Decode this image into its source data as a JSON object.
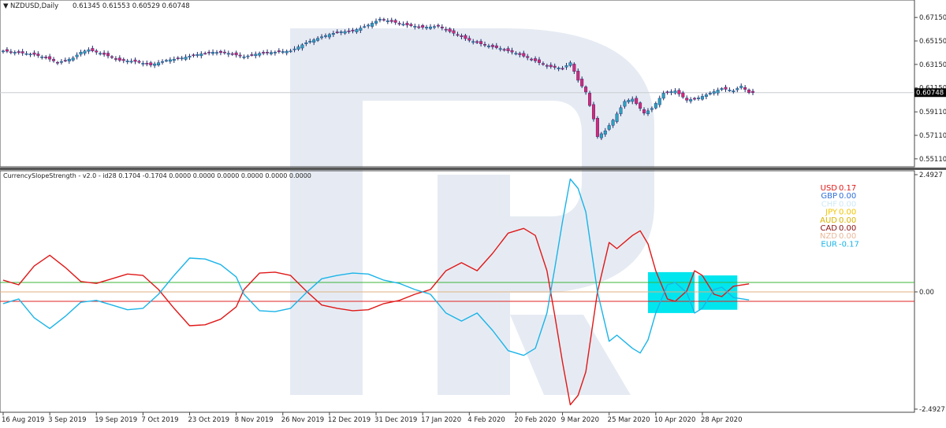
{
  "chart_data": [
    {
      "type": "candlestick",
      "symbol_label": "NZDUSD,Daily",
      "ohlc_label": "0.61345 0.61553 0.60529 0.60748",
      "last_price": 0.60748,
      "last_price_label": "0.60748",
      "ylim": [
        0.547,
        0.681
      ],
      "y_ticks": [
        "0.67150",
        "0.65150",
        "0.63150",
        "0.61150",
        "0.59110",
        "0.57110",
        "0.55110"
      ],
      "y_tick_values": [
        0.6715,
        0.6515,
        0.6315,
        0.6115,
        0.5911,
        0.5711,
        0.5511
      ],
      "x_range": [
        0,
        193
      ],
      "close_series": [
        {
          "x": 0,
          "y": 0.643
        },
        {
          "x": 8,
          "y": 0.64
        },
        {
          "x": 12,
          "y": 0.636
        },
        {
          "x": 14,
          "y": 0.633
        },
        {
          "x": 18,
          "y": 0.637
        },
        {
          "x": 20,
          "y": 0.642
        },
        {
          "x": 22,
          "y": 0.644
        },
        {
          "x": 26,
          "y": 0.64
        },
        {
          "x": 30,
          "y": 0.635
        },
        {
          "x": 34,
          "y": 0.634
        },
        {
          "x": 38,
          "y": 0.631
        },
        {
          "x": 42,
          "y": 0.635
        },
        {
          "x": 46,
          "y": 0.637
        },
        {
          "x": 50,
          "y": 0.64
        },
        {
          "x": 54,
          "y": 0.642
        },
        {
          "x": 58,
          "y": 0.641
        },
        {
          "x": 62,
          "y": 0.638
        },
        {
          "x": 66,
          "y": 0.641
        },
        {
          "x": 70,
          "y": 0.642
        },
        {
          "x": 74,
          "y": 0.643
        },
        {
          "x": 78,
          "y": 0.65
        },
        {
          "x": 82,
          "y": 0.655
        },
        {
          "x": 86,
          "y": 0.659
        },
        {
          "x": 90,
          "y": 0.66
        },
        {
          "x": 94,
          "y": 0.665
        },
        {
          "x": 97,
          "y": 0.67
        },
        {
          "x": 100,
          "y": 0.668
        },
        {
          "x": 104,
          "y": 0.665
        },
        {
          "x": 108,
          "y": 0.663
        },
        {
          "x": 112,
          "y": 0.664
        },
        {
          "x": 116,
          "y": 0.658
        },
        {
          "x": 120,
          "y": 0.652
        },
        {
          "x": 124,
          "y": 0.648
        },
        {
          "x": 128,
          "y": 0.645
        },
        {
          "x": 132,
          "y": 0.641
        },
        {
          "x": 136,
          "y": 0.636
        },
        {
          "x": 140,
          "y": 0.63
        },
        {
          "x": 144,
          "y": 0.628
        },
        {
          "x": 146,
          "y": 0.633
        },
        {
          "x": 148,
          "y": 0.618
        },
        {
          "x": 150,
          "y": 0.608
        },
        {
          "x": 152,
          "y": 0.585
        },
        {
          "x": 153,
          "y": 0.57
        },
        {
          "x": 155,
          "y": 0.575
        },
        {
          "x": 157,
          "y": 0.584
        },
        {
          "x": 160,
          "y": 0.6
        },
        {
          "x": 162,
          "y": 0.602
        },
        {
          "x": 165,
          "y": 0.59
        },
        {
          "x": 167,
          "y": 0.594
        },
        {
          "x": 170,
          "y": 0.607
        },
        {
          "x": 173,
          "y": 0.609
        },
        {
          "x": 176,
          "y": 0.601
        },
        {
          "x": 179,
          "y": 0.603
        },
        {
          "x": 182,
          "y": 0.607
        },
        {
          "x": 185,
          "y": 0.611
        },
        {
          "x": 188,
          "y": 0.609
        },
        {
          "x": 190,
          "y": 0.613
        },
        {
          "x": 192,
          "y": 0.6075
        }
      ]
    },
    {
      "type": "line",
      "indicator_label": "CurrencySlopeStrength - v2.0 - id28 0.1704 -0.1704 0.0000 0.0000 0.0000 0.0000 0.0000 0.0000",
      "ylim": [
        -2.4927,
        2.4927
      ],
      "y_ticks": [
        "2.4927",
        "0.00",
        "-2.4927"
      ],
      "y_tick_values": [
        2.4927,
        0,
        -2.4927
      ],
      "levels": [
        {
          "value": 0.2,
          "color": "#3ab53a"
        },
        {
          "value": 0.0,
          "color": "#e0b080"
        },
        {
          "value": -0.2,
          "color": "#e02020"
        }
      ],
      "categories": [
        "16 Aug 2019",
        "3 Sep 2019",
        "19 Sep 2019",
        "7 Oct 2019",
        "23 Oct 2019",
        "8 Nov 2019",
        "26 Nov 2019",
        "12 Dec 2019",
        "31 Dec 2019",
        "17 Jan 2020",
        "4 Feb 2020",
        "20 Feb 2020",
        "9 Mar 2020",
        "25 Mar 2020",
        "10 Apr 2020",
        "28 Apr 2020"
      ],
      "category_positions": [
        0,
        12,
        24,
        36,
        48,
        60,
        72,
        84,
        96,
        108,
        120,
        132,
        144,
        156,
        168,
        180
      ],
      "x_range": [
        0,
        193
      ],
      "series": [
        {
          "color": "#e01818",
          "values": [
            {
              "x": 0,
              "y": 0.25
            },
            {
              "x": 4,
              "y": 0.15
            },
            {
              "x": 8,
              "y": 0.55
            },
            {
              "x": 12,
              "y": 0.78
            },
            {
              "x": 16,
              "y": 0.52
            },
            {
              "x": 20,
              "y": 0.22
            },
            {
              "x": 24,
              "y": 0.18
            },
            {
              "x": 28,
              "y": 0.28
            },
            {
              "x": 32,
              "y": 0.38
            },
            {
              "x": 36,
              "y": 0.35
            },
            {
              "x": 40,
              "y": 0.05
            },
            {
              "x": 44,
              "y": -0.35
            },
            {
              "x": 48,
              "y": -0.72
            },
            {
              "x": 52,
              "y": -0.7
            },
            {
              "x": 56,
              "y": -0.58
            },
            {
              "x": 60,
              "y": -0.32
            },
            {
              "x": 62,
              "y": 0.05
            },
            {
              "x": 66,
              "y": 0.4
            },
            {
              "x": 70,
              "y": 0.42
            },
            {
              "x": 74,
              "y": 0.35
            },
            {
              "x": 78,
              "y": 0.02
            },
            {
              "x": 82,
              "y": -0.28
            },
            {
              "x": 86,
              "y": -0.35
            },
            {
              "x": 90,
              "y": -0.4
            },
            {
              "x": 94,
              "y": -0.38
            },
            {
              "x": 98,
              "y": -0.25
            },
            {
              "x": 102,
              "y": -0.18
            },
            {
              "x": 106,
              "y": -0.05
            },
            {
              "x": 110,
              "y": 0.05
            },
            {
              "x": 114,
              "y": 0.45
            },
            {
              "x": 118,
              "y": 0.62
            },
            {
              "x": 122,
              "y": 0.45
            },
            {
              "x": 126,
              "y": 0.82
            },
            {
              "x": 130,
              "y": 1.25
            },
            {
              "x": 134,
              "y": 1.35
            },
            {
              "x": 137,
              "y": 1.2
            },
            {
              "x": 140,
              "y": 0.45
            },
            {
              "x": 142,
              "y": -0.5
            },
            {
              "x": 144,
              "y": -1.5
            },
            {
              "x": 146,
              "y": -2.4
            },
            {
              "x": 148,
              "y": -2.2
            },
            {
              "x": 150,
              "y": -1.7
            },
            {
              "x": 153,
              "y": 0.0
            },
            {
              "x": 156,
              "y": 1.05
            },
            {
              "x": 158,
              "y": 0.92
            },
            {
              "x": 162,
              "y": 1.2
            },
            {
              "x": 164,
              "y": 1.3
            },
            {
              "x": 166,
              "y": 1.02
            },
            {
              "x": 168,
              "y": 0.45
            },
            {
              "x": 171,
              "y": -0.15
            },
            {
              "x": 173,
              "y": -0.2
            },
            {
              "x": 176,
              "y": 0.02
            },
            {
              "x": 178,
              "y": 0.45
            },
            {
              "x": 180,
              "y": 0.35
            },
            {
              "x": 183,
              "y": -0.05
            },
            {
              "x": 185,
              "y": -0.1
            },
            {
              "x": 188,
              "y": 0.12
            },
            {
              "x": 192,
              "y": 0.17
            }
          ]
        },
        {
          "color": "#1ab4e8",
          "values": [
            {
              "x": 0,
              "y": -0.25
            },
            {
              "x": 4,
              "y": -0.15
            },
            {
              "x": 8,
              "y": -0.55
            },
            {
              "x": 12,
              "y": -0.78
            },
            {
              "x": 16,
              "y": -0.52
            },
            {
              "x": 20,
              "y": -0.22
            },
            {
              "x": 24,
              "y": -0.18
            },
            {
              "x": 28,
              "y": -0.28
            },
            {
              "x": 32,
              "y": -0.38
            },
            {
              "x": 36,
              "y": -0.35
            },
            {
              "x": 40,
              "y": -0.05
            },
            {
              "x": 44,
              "y": 0.35
            },
            {
              "x": 48,
              "y": 0.72
            },
            {
              "x": 52,
              "y": 0.7
            },
            {
              "x": 56,
              "y": 0.58
            },
            {
              "x": 60,
              "y": 0.32
            },
            {
              "x": 62,
              "y": -0.05
            },
            {
              "x": 66,
              "y": -0.4
            },
            {
              "x": 70,
              "y": -0.42
            },
            {
              "x": 74,
              "y": -0.35
            },
            {
              "x": 78,
              "y": -0.02
            },
            {
              "x": 82,
              "y": 0.28
            },
            {
              "x": 86,
              "y": 0.35
            },
            {
              "x": 90,
              "y": 0.4
            },
            {
              "x": 94,
              "y": 0.38
            },
            {
              "x": 98,
              "y": 0.25
            },
            {
              "x": 102,
              "y": 0.18
            },
            {
              "x": 106,
              "y": 0.05
            },
            {
              "x": 110,
              "y": -0.05
            },
            {
              "x": 114,
              "y": -0.45
            },
            {
              "x": 118,
              "y": -0.62
            },
            {
              "x": 122,
              "y": -0.45
            },
            {
              "x": 126,
              "y": -0.82
            },
            {
              "x": 130,
              "y": -1.25
            },
            {
              "x": 134,
              "y": -1.35
            },
            {
              "x": 137,
              "y": -1.2
            },
            {
              "x": 140,
              "y": -0.45
            },
            {
              "x": 142,
              "y": 0.5
            },
            {
              "x": 144,
              "y": 1.5
            },
            {
              "x": 146,
              "y": 2.4
            },
            {
              "x": 148,
              "y": 2.2
            },
            {
              "x": 150,
              "y": 1.7
            },
            {
              "x": 153,
              "y": 0.0
            },
            {
              "x": 156,
              "y": -1.05
            },
            {
              "x": 158,
              "y": -0.92
            },
            {
              "x": 162,
              "y": -1.2
            },
            {
              "x": 164,
              "y": -1.3
            },
            {
              "x": 166,
              "y": -1.02
            },
            {
              "x": 168,
              "y": -0.45
            },
            {
              "x": 171,
              "y": 0.15
            },
            {
              "x": 173,
              "y": 0.2
            },
            {
              "x": 176,
              "y": -0.02
            },
            {
              "x": 178,
              "y": -0.45
            },
            {
              "x": 180,
              "y": -0.35
            },
            {
              "x": 183,
              "y": 0.05
            },
            {
              "x": 185,
              "y": 0.1
            },
            {
              "x": 188,
              "y": -0.12
            },
            {
              "x": 192,
              "y": -0.17
            }
          ]
        }
      ],
      "highlight_boxes": [
        {
          "x_range": [
            166,
            178
          ],
          "y_range": [
            -0.45,
            0.42
          ],
          "color": "#00e5ee"
        },
        {
          "x_range": [
            179,
            189
          ],
          "y_range": [
            -0.38,
            0.35
          ],
          "color": "#00e5ee"
        }
      ],
      "legend_position": "top-right",
      "legend": [
        {
          "label": "USD",
          "value": "0.17",
          "color": "#e01818"
        },
        {
          "label": "GBP",
          "value": "0.00",
          "color": "#2f6fd6"
        },
        {
          "label": "CHF",
          "value": "0.00",
          "color": "#cfe9f7"
        },
        {
          "label": "JPY",
          "value": "0.00",
          "color": "#f2c500"
        },
        {
          "label": "AUD",
          "value": "0.00",
          "color": "#d9b400"
        },
        {
          "label": "CAD",
          "value": "0.00",
          "color": "#8a1010"
        },
        {
          "label": "NZD",
          "value": "0.00",
          "color": "#e8b89a"
        },
        {
          "label": "EUR",
          "value": "-0.17",
          "color": "#1ab4e8"
        }
      ]
    }
  ]
}
